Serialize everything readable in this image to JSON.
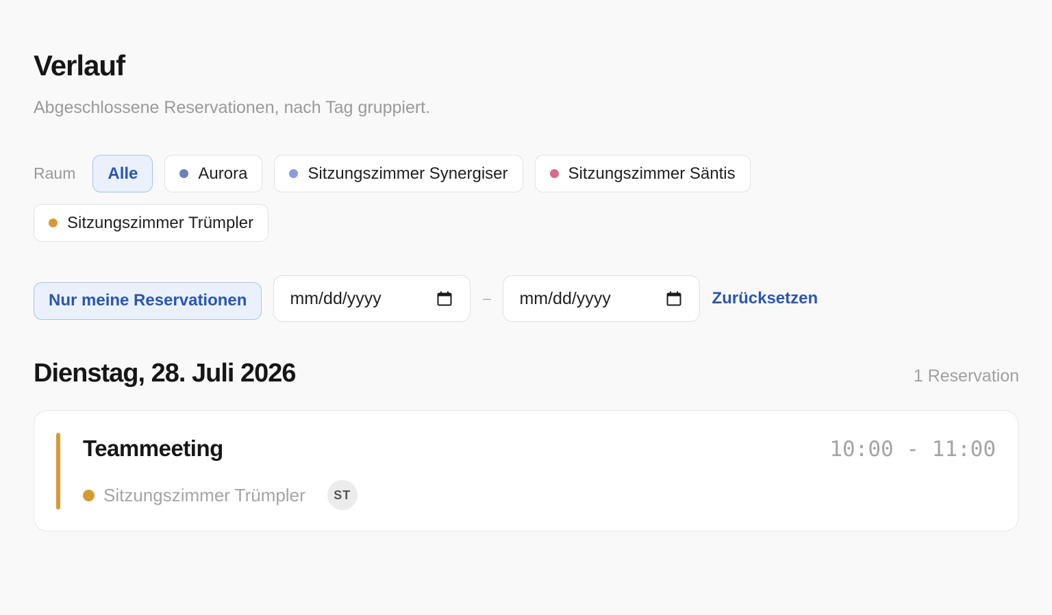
{
  "header": {
    "title": "Verlauf",
    "subtitle": "Abgeschlossene Reservationen, nach Tag gruppiert."
  },
  "room_filter": {
    "label": "Raum",
    "chips": [
      {
        "label": "Alle",
        "active": true,
        "color": null
      },
      {
        "label": "Aurora",
        "active": false,
        "color": "#6b81b8"
      },
      {
        "label": "Sitzungszimmer Synergiser",
        "active": false,
        "color": "#8a9be0"
      },
      {
        "label": "Sitzungszimmer Säntis",
        "active": false,
        "color": "#d66a8f"
      },
      {
        "label": "Sitzungszimmer Trümpler",
        "active": false,
        "color": "#d69a35"
      }
    ]
  },
  "controls": {
    "my_reservations_label": "Nur meine Reservationen",
    "date_from_placeholder": "mm/dd/yyyy",
    "date_separator": "–",
    "date_to_placeholder": "mm/dd/yyyy",
    "reset_label": "Zurücksetzen",
    "calendar_icon": "calendar-icon"
  },
  "days": [
    {
      "heading": "Dienstag, 28. Juli 2026",
      "count_label": "1 Reservation",
      "reservations": [
        {
          "title": "Teammeeting",
          "time": "10:00 - 11:00",
          "room": "Sitzungszimmer Trümpler",
          "room_color": "#d69a35",
          "initials": "ST"
        }
      ]
    }
  ],
  "colors": {
    "accent": "#2a56b2",
    "accent_bg": "#eaf1fc",
    "background": "#f9f9f9"
  }
}
